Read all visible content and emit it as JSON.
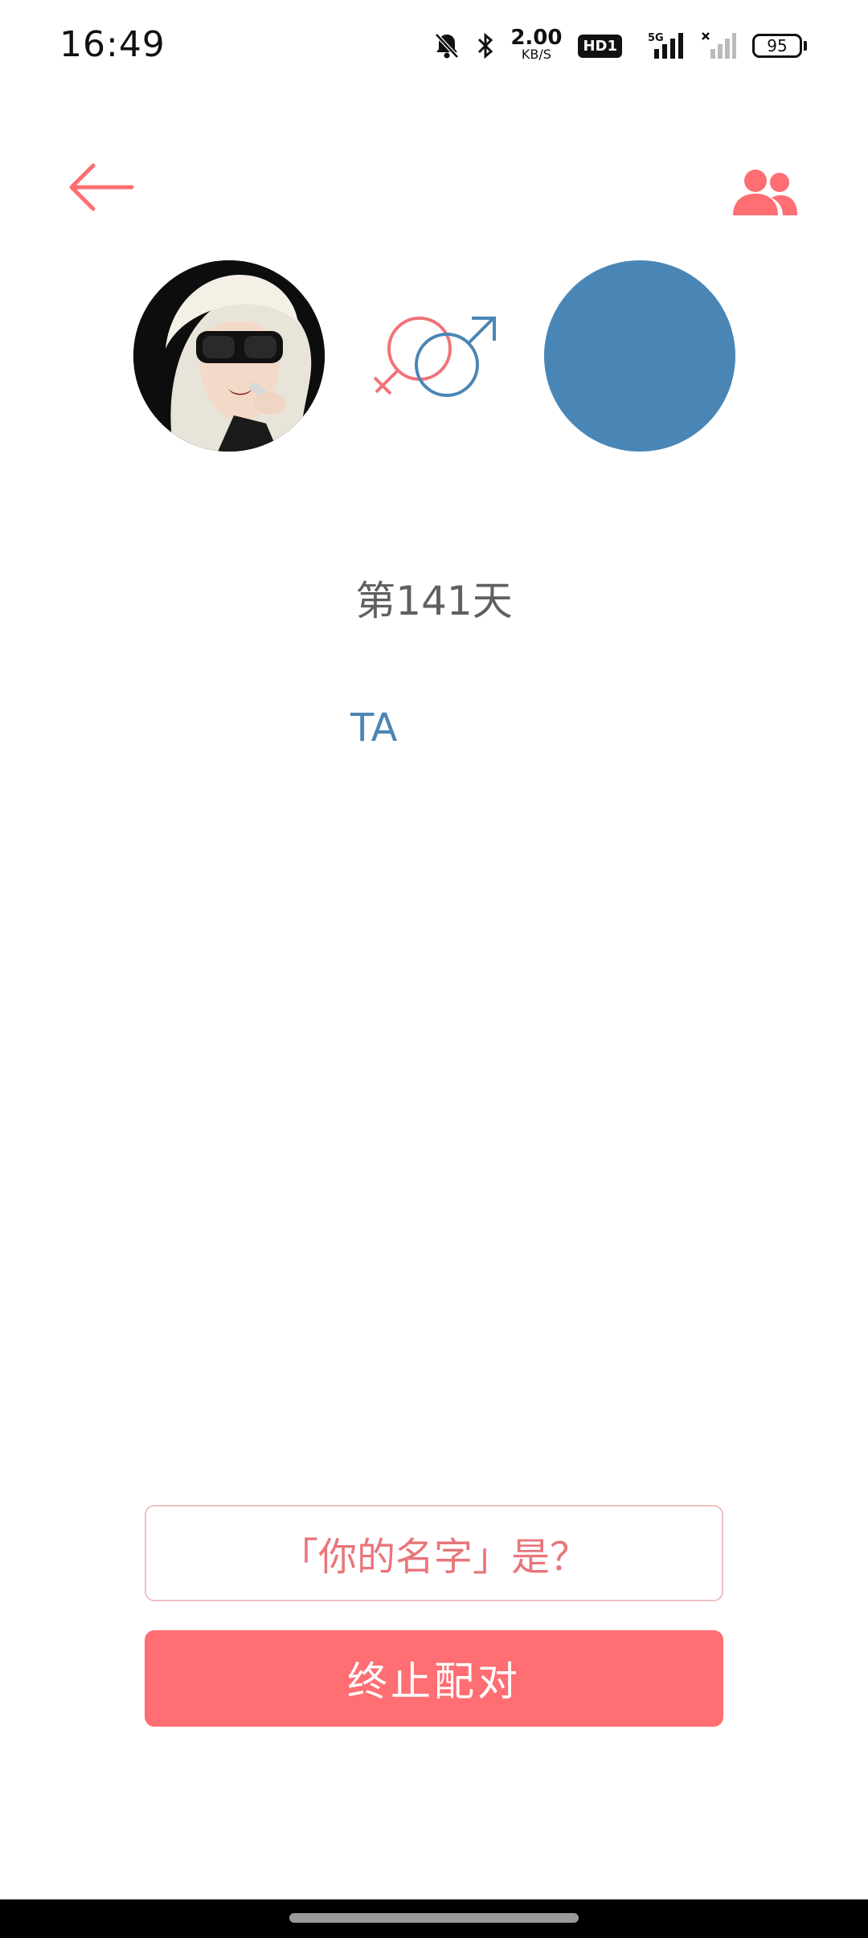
{
  "status_bar": {
    "time": "16:49",
    "net_speed_value": "2.00",
    "net_speed_unit": "KB/S",
    "hd_badge": "HD1",
    "network_type": "5G",
    "battery_level": "95",
    "icons": [
      "mute-bell-icon",
      "bluetooth-icon",
      "hd-icon",
      "signal-5g-icon",
      "signal-no-sim-icon",
      "battery-icon"
    ]
  },
  "nav": {
    "back_icon": "back-arrow-icon",
    "people_icon": "people-icon"
  },
  "couple": {
    "gender_icon": "female-male-symbol-icon",
    "partner_avatar_color": "#4a86b5",
    "day_counter": "第141天",
    "partner_name": "TA"
  },
  "actions": {
    "ask_name_label": "「你的名字」是？",
    "end_match_label": "终止配对"
  },
  "colors": {
    "accent": "#fe6e72",
    "partner_blue": "#4a86b5",
    "text_gray": "#606060"
  }
}
